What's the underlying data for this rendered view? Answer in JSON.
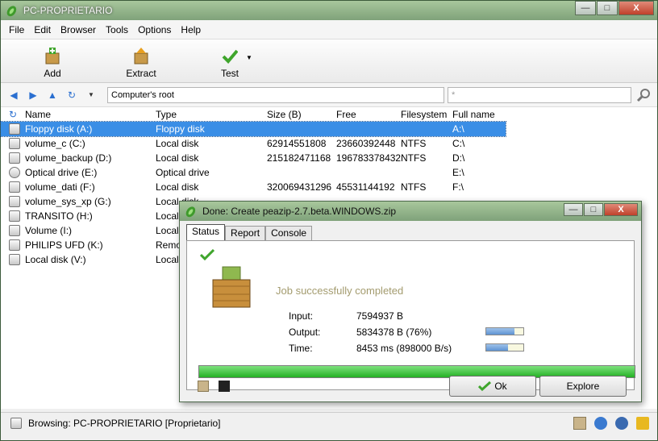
{
  "window": {
    "title": "PC-PROPRIETARIO",
    "min": "—",
    "max": "□",
    "close": "X"
  },
  "menu": [
    "File",
    "Edit",
    "Browser",
    "Tools",
    "Options",
    "Help"
  ],
  "toolbar": {
    "add": "Add",
    "extract": "Extract",
    "test": "Test",
    "more": "▼"
  },
  "address": {
    "path": "Computer's root",
    "filter": "*"
  },
  "columns": [
    "Name",
    "Type",
    "Size (B)",
    "Free",
    "Filesystem",
    "Full name"
  ],
  "rows": [
    {
      "name": "Floppy disk (A:)",
      "type": "Floppy disk",
      "size": "",
      "free": "",
      "fs": "",
      "full": "A:\\"
    },
    {
      "name": "volume_c (C:)",
      "type": "Local disk",
      "size": "62914551808",
      "free": "23660392448",
      "fs": "NTFS",
      "full": "C:\\"
    },
    {
      "name": "volume_backup (D:)",
      "type": "Local disk",
      "size": "215182471168",
      "free": "196783378432",
      "fs": "NTFS",
      "full": "D:\\"
    },
    {
      "name": "Optical drive (E:)",
      "type": "Optical drive",
      "size": "",
      "free": "",
      "fs": "",
      "full": "E:\\"
    },
    {
      "name": "volume_dati (F:)",
      "type": "Local disk",
      "size": "320069431296",
      "free": "45531144192",
      "fs": "NTFS",
      "full": "F:\\"
    },
    {
      "name": "volume_sys_xp (G:)",
      "type": "Local disk",
      "size": "",
      "free": "",
      "fs": "",
      "full": ""
    },
    {
      "name": "TRANSITO (H:)",
      "type": "Local",
      "size": "",
      "free": "",
      "fs": "",
      "full": ""
    },
    {
      "name": "Volume (I:)",
      "type": "Local",
      "size": "",
      "free": "",
      "fs": "",
      "full": ""
    },
    {
      "name": "PHILIPS UFD (K:)",
      "type": "Remo",
      "size": "",
      "free": "",
      "fs": "",
      "full": ""
    },
    {
      "name": "Local disk (V:)",
      "type": "Local",
      "size": "",
      "free": "",
      "fs": "",
      "full": ""
    }
  ],
  "status": {
    "text": "Browsing: PC-PROPRIETARIO [Proprietario]"
  },
  "dialog": {
    "title": "Done: Create peazip-2.7.beta.WINDOWS.zip",
    "tabs": [
      "Status",
      "Report",
      "Console"
    ],
    "message": "Job successfully completed",
    "input_label": "Input:",
    "input_value": "7594937 B",
    "output_label": "Output:",
    "output_value": "5834378 B (76%)",
    "time_label": "Time:",
    "time_value": "8453 ms (898000 B/s)",
    "output_ratio": 0.76,
    "speed_ratio": 0.58,
    "progress": 1.0,
    "ok": "Ok",
    "explore": "Explore"
  },
  "colors": {
    "accent": "#3a8ee6",
    "progress": "#23b023"
  }
}
